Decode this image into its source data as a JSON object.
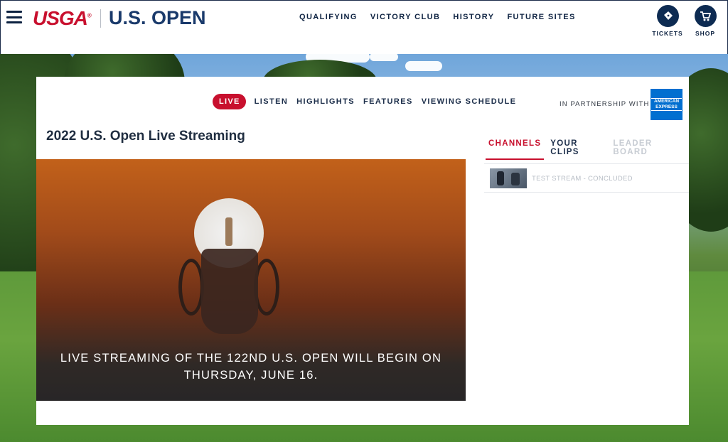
{
  "header": {
    "brand_usga": "USGA",
    "brand_usopen": "U.S. OPEN",
    "nav": [
      "QUALIFYING",
      "VICTORY CLUB",
      "HISTORY",
      "FUTURE SITES"
    ],
    "actions": [
      {
        "label": "TICKETS",
        "icon": "ticket-icon"
      },
      {
        "label": "SHOP",
        "icon": "cart-icon"
      }
    ]
  },
  "subnav": {
    "live": "LIVE",
    "items": [
      "LISTEN",
      "HIGHLIGHTS",
      "FEATURES",
      "VIEWING SCHEDULE"
    ],
    "partner_text": "IN PARTNERSHIP WITH",
    "partner_logo_text": [
      "AMERICAN",
      "EXPRESS"
    ]
  },
  "main": {
    "title": "2022 U.S. Open Live Streaming",
    "video_caption_line1": "LIVE STREAMING OF THE 122ND U.S. OPEN WILL BEGIN ON",
    "video_caption_line2": "THURSDAY, JUNE 16."
  },
  "panel": {
    "tabs": [
      "CHANNELS",
      "YOUR CLIPS",
      "LEADER BOARD"
    ],
    "active_tab": "CHANNELS",
    "channels": [
      {
        "label": "TEST STREAM - CONCLUDED"
      }
    ]
  },
  "colors": {
    "accent_red": "#c8102e",
    "navy": "#0d2241",
    "amex_blue": "#016fd0"
  }
}
